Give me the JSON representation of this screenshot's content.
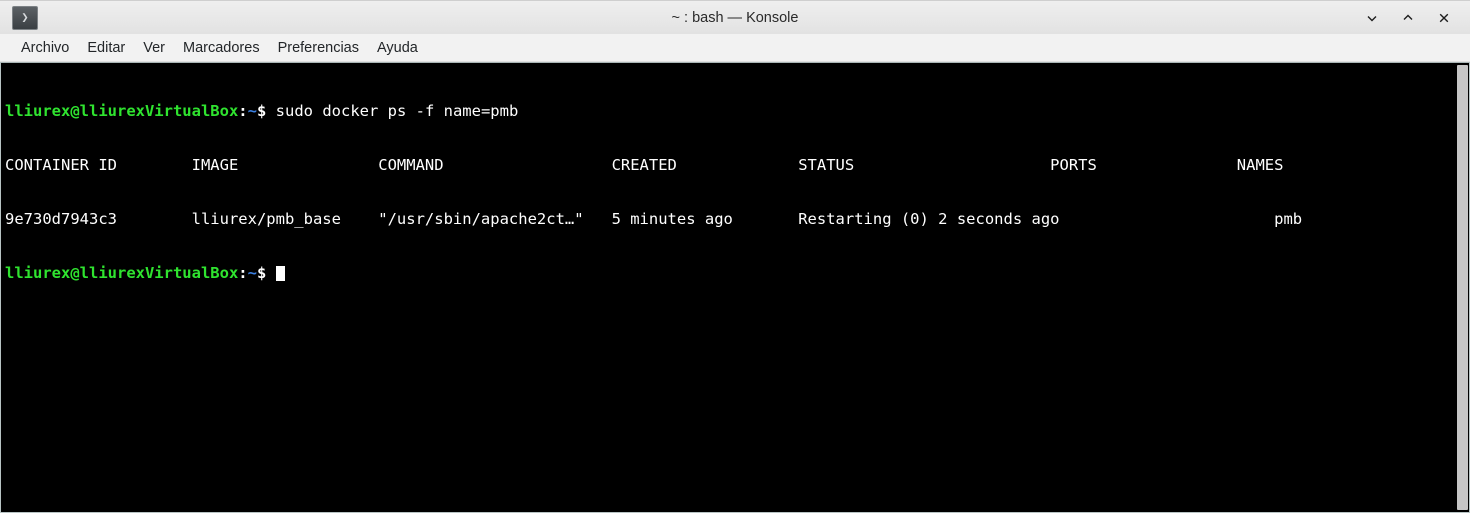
{
  "window": {
    "title": "~ : bash — Konsole",
    "tab_icon": "terminal-prompt-icon",
    "controls": {
      "minimize": "chevron-down-icon",
      "maximize": "chevron-up-icon",
      "close": "close-icon"
    }
  },
  "menubar": {
    "items": [
      {
        "label": "Archivo"
      },
      {
        "label": "Editar"
      },
      {
        "label": "Ver"
      },
      {
        "label": "Marcadores"
      },
      {
        "label": "Preferencias"
      },
      {
        "label": "Ayuda"
      }
    ]
  },
  "terminal": {
    "prompt": {
      "user_host": "lliurex@lliurexVirtualBox",
      "colon": ":",
      "path": "~",
      "dollar": "$"
    },
    "command": " sudo docker ps -f name=pmb",
    "table": {
      "header": "CONTAINER ID        IMAGE               COMMAND                  CREATED             STATUS                     PORTS               NAMES",
      "row": "9e730d7943c3        lliurex/pmb_base    \"/usr/sbin/apache2ct…\"   5 minutes ago       Restarting (0) 2 seconds ago                       pmb",
      "columns": [
        "CONTAINER ID",
        "IMAGE",
        "COMMAND",
        "CREATED",
        "STATUS",
        "PORTS",
        "NAMES"
      ],
      "values": {
        "container_id": "9e730d7943c3",
        "image": "lliurex/pmb_base",
        "command": "\"/usr/sbin/apache2ct…\"",
        "created": "5 minutes ago",
        "status": "Restarting (0) 2 seconds ago",
        "ports": "",
        "names": "pmb"
      }
    }
  }
}
